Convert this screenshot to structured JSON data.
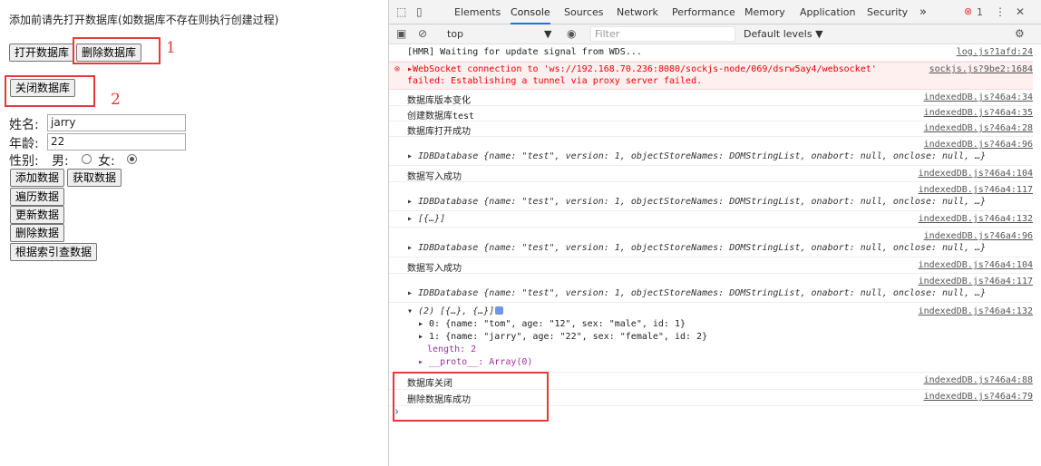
{
  "left": {
    "note": "添加前请先打开数据库(如数据库不存在则执行创建过程)",
    "open_btn": "打开数据库",
    "delete_db_btn": "删除数据库",
    "mark1": "1",
    "close_btn": "关闭数据库",
    "mark2": "2",
    "name_label": "姓名:",
    "name_value": "jarry",
    "age_label": "年龄:",
    "age_value": "22",
    "sex_label": "性别:",
    "male_label": "男:",
    "female_label": "女:",
    "add_btn": "添加数据",
    "get_btn": "获取数据",
    "iterate_btn": "遍历数据",
    "update_btn": "更新数据",
    "delete_btn": "删除数据",
    "index_btn": "根据索引查数据"
  },
  "devtools": {
    "tabs": [
      "Elements",
      "Console",
      "Sources",
      "Network",
      "Performance",
      "Memory",
      "Application",
      "Security"
    ],
    "more": "»",
    "error_count": "1",
    "context": "top",
    "filter_placeholder": "Filter",
    "levels": "Default levels ▼",
    "messages": [
      {
        "text": "[HMR] Waiting for update signal from WDS...",
        "src": "log.js?1afd:24"
      },
      {
        "text": "▸WebSocket connection to 'ws://192.168.70.236:8080/sockjs-node/069/dsrw5ay4/websocket'",
        "text2": "failed: Establishing a tunnel via proxy server failed.",
        "src": "sockjs.js?9be2:1684"
      },
      {
        "text": "数据库版本变化",
        "src": "indexedDB.js?46a4:34"
      },
      {
        "text": "创建数据库test",
        "src": "indexedDB.js?46a4:35"
      },
      {
        "text": "数据库打开成功",
        "src": "indexedDB.js?46a4:28"
      },
      {
        "text": "▸ IDBDatabase {name: \"test\", version: 1, objectStoreNames: DOMStringList, onabort: null, onclose: null, …}",
        "src": "indexedDB.js?46a4:96"
      },
      {
        "text": "数据写入成功",
        "src": "indexedDB.js?46a4:104"
      },
      {
        "text": "▸ IDBDatabase {name: \"test\", version: 1, objectStoreNames: DOMStringList, onabort: null, onclose: null, …}",
        "src": "indexedDB.js?46a4:117"
      },
      {
        "text": "▸ [{…}]",
        "src": "indexedDB.js?46a4:132"
      },
      {
        "text": "▸ IDBDatabase {name: \"test\", version: 1, objectStoreNames: DOMStringList, onabort: null, onclose: null, …}",
        "src": "indexedDB.js?46a4:96"
      },
      {
        "text": "数据写入成功",
        "src": "indexedDB.js?46a4:104"
      },
      {
        "text": "▸ IDBDatabase {name: \"test\", version: 1, objectStoreNames: DOMStringList, onabort: null, onclose: null, …}",
        "src": "indexedDB.js?46a4:117"
      },
      {
        "text": "▾ (2) [{…}, {…}]",
        "src": "indexedDB.js?46a4:132"
      },
      {
        "text": "数据库关闭",
        "src": "indexedDB.js?46a4:88"
      },
      {
        "text": "删除数据库成功",
        "src": "indexedDB.js?46a4:79"
      }
    ],
    "array_items": [
      "▸ 0: {name: \"tom\", age: \"12\", sex: \"male\", id: 1}",
      "▸ 1: {name: \"jarry\", age: \"22\", sex: \"female\", id: 2}",
      "length: 2",
      "▸ __proto__: Array(0)"
    ],
    "prompt": "›"
  }
}
